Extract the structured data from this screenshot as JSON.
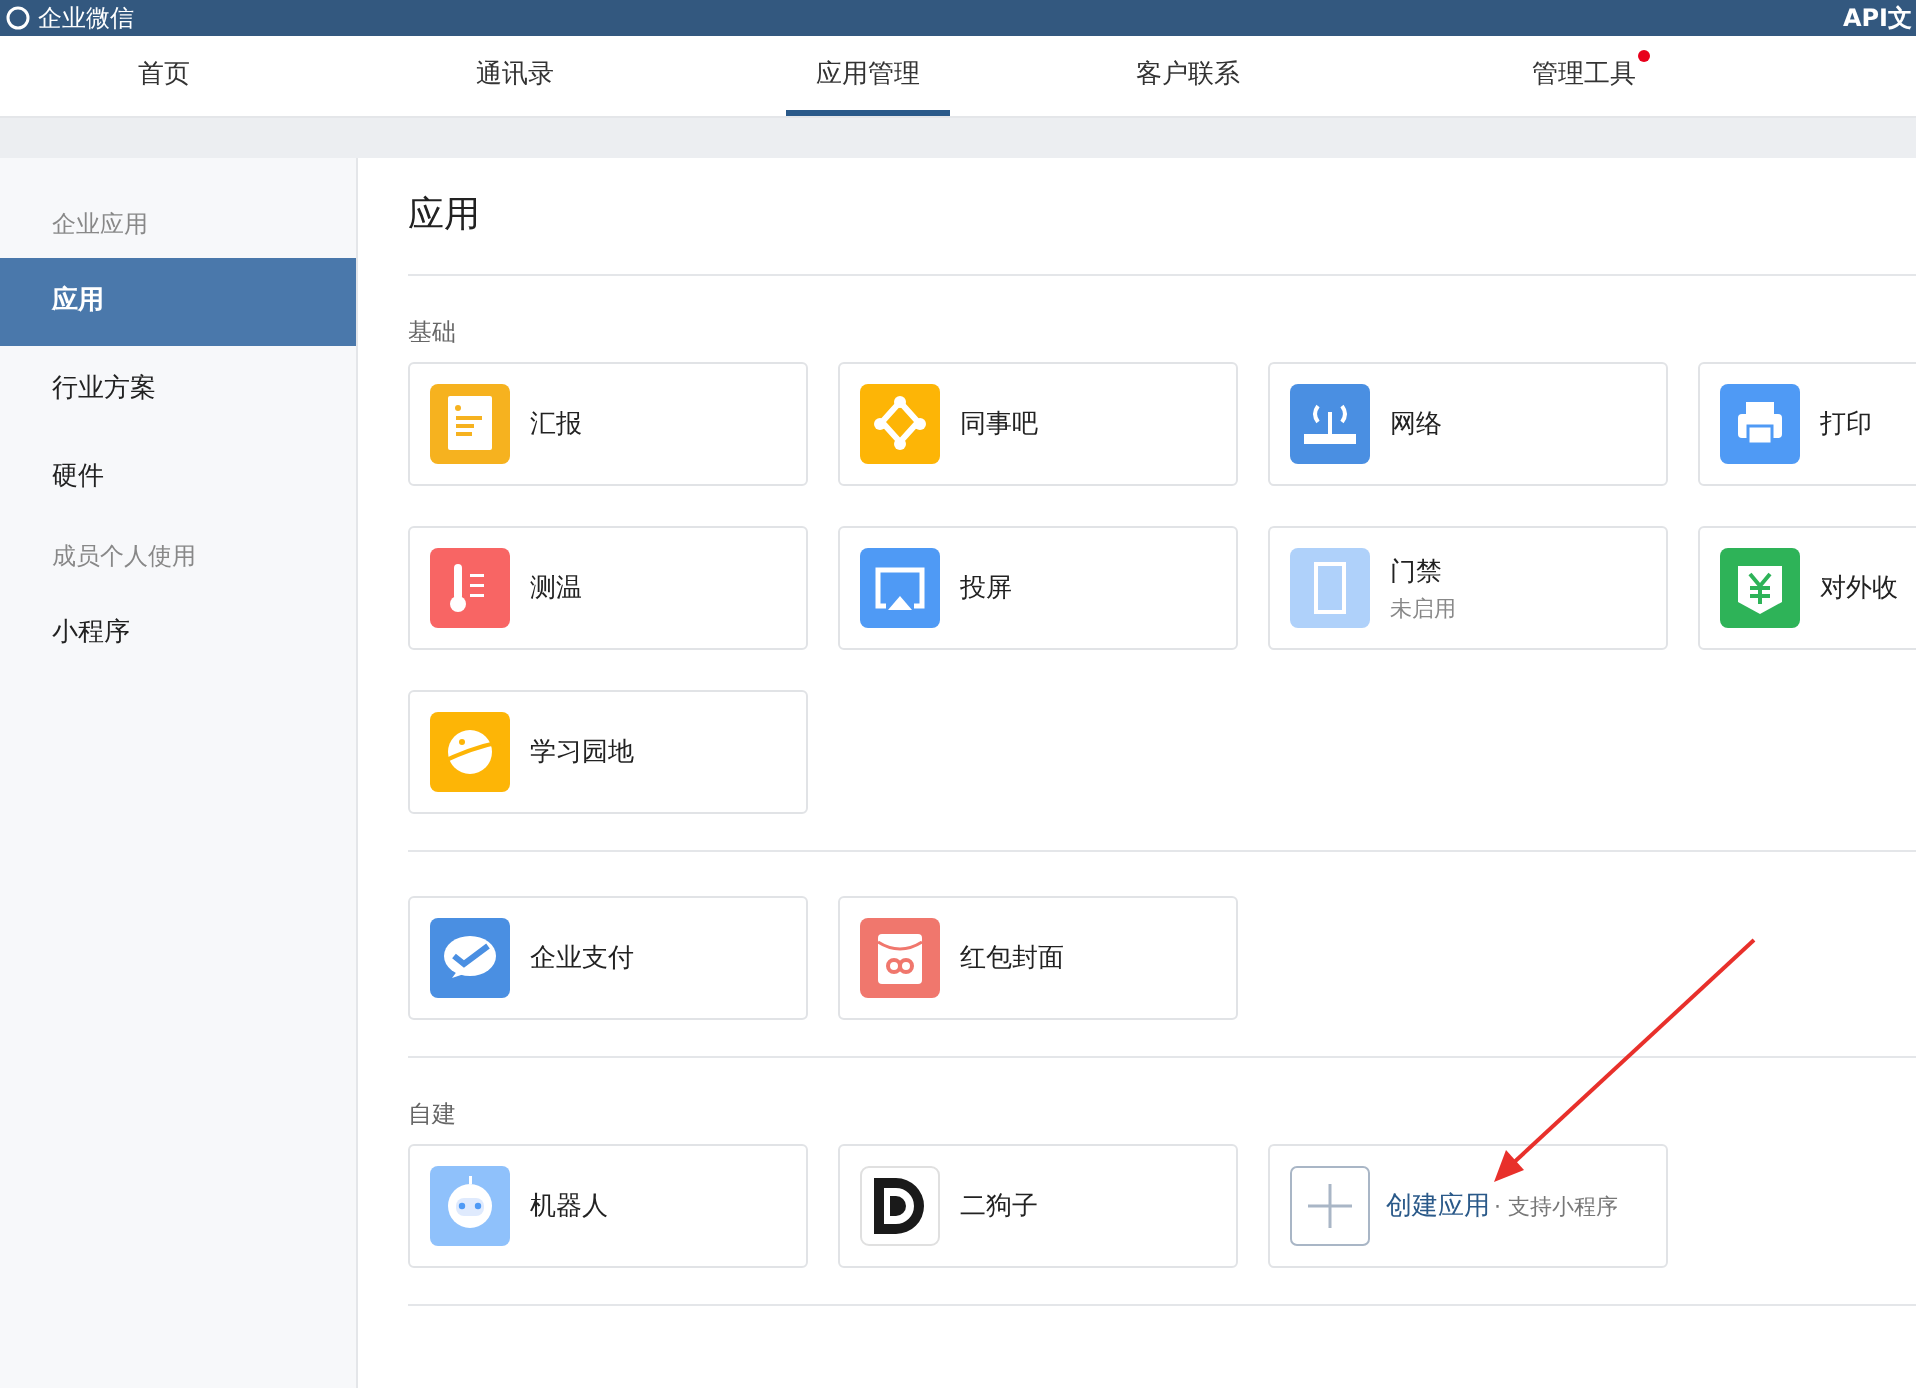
{
  "top_bar": {
    "logo": "企业微信",
    "link": "API文"
  },
  "nav_tabs": [
    {
      "label": "首页",
      "selected": false,
      "badge": false
    },
    {
      "label": "通讯录",
      "selected": false,
      "badge": false
    },
    {
      "label": "应用管理",
      "selected": true,
      "badge": false
    },
    {
      "label": "客户联系",
      "selected": false,
      "badge": false
    },
    {
      "label": "管理工具",
      "selected": false,
      "badge": true
    }
  ],
  "sidebar": {
    "groups": [
      {
        "heading": "企业应用",
        "items": [
          {
            "label": "应用",
            "selected": true
          },
          {
            "label": "行业方案",
            "selected": false
          },
          {
            "label": "硬件",
            "selected": false
          }
        ]
      },
      {
        "heading": "成员个人使用",
        "items": [
          {
            "label": "小程序",
            "selected": false
          }
        ]
      }
    ]
  },
  "page_title": "应用",
  "sections": [
    {
      "heading": "基础",
      "apps": [
        {
          "name": "汇报",
          "disabled": false
        },
        {
          "name": "同事吧",
          "disabled": false
        },
        {
          "name": "网络",
          "disabled": false
        },
        {
          "name": "打印",
          "disabled": false
        },
        {
          "name": "测温",
          "disabled": false
        },
        {
          "name": "投屏",
          "disabled": false
        },
        {
          "name": "门禁",
          "status": "未启用",
          "disabled": true
        },
        {
          "name": "对外收",
          "disabled": false
        },
        {
          "name": "学习园地",
          "disabled": false
        }
      ]
    },
    {
      "apps": [
        {
          "name": "企业支付",
          "disabled": false
        },
        {
          "name": "红包封面",
          "disabled": false
        }
      ]
    },
    {
      "heading": "自建",
      "apps": [
        {
          "name": "机器人",
          "disabled": false
        },
        {
          "name": "二狗子",
          "disabled": false
        }
      ],
      "create": {
        "label": "创建应用",
        "hint": "· 支持小程序"
      }
    }
  ]
}
